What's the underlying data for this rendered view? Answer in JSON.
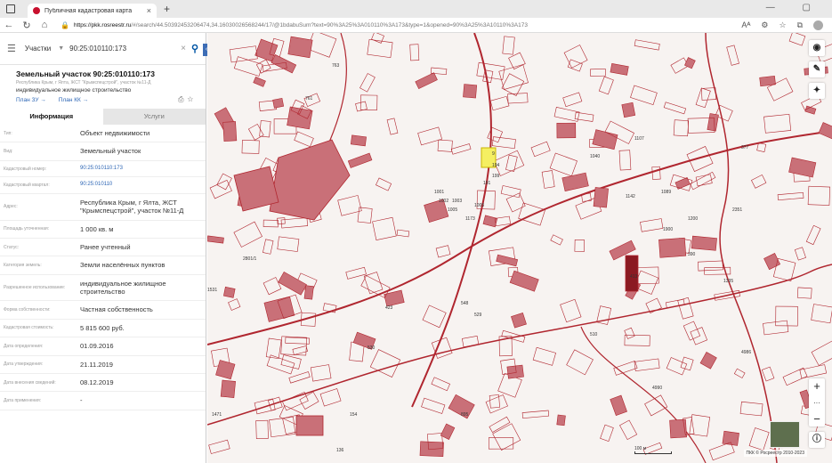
{
  "browser": {
    "tab_title": "Публичная кадастровая карта",
    "tab_close": "×",
    "new_tab": "+",
    "url_host": "https://pkk.rosreestr.ru",
    "url_rest": "/#/search/44.50392453206474,34.16030026568244/17/@1bdabuSum?text=90%3A25%3A010110%3A173&type=1&opened=90%3A25%3A10110%3A173",
    "aa_label": "Aᴬ"
  },
  "search": {
    "category": "Участки",
    "value": "90:25:010110:173"
  },
  "object": {
    "title": "Земельный участок 90:25:010110:173",
    "address_small": "Республика Крым, г Ялта, ЖСТ \"Крымспецстрой\", участок №11-Д",
    "use": "индивидуальное жилищное строительство",
    "plan_zu": "План ЗУ →",
    "plan_kk": "План КК →"
  },
  "tabs": {
    "info": "Информация",
    "services": "Услуги"
  },
  "rows": [
    {
      "k": "Тип:",
      "v": "Объект недвижимости",
      "link": false
    },
    {
      "k": "Вид:",
      "v": "Земельный участок",
      "link": false
    },
    {
      "k": "Кадастровый номер:",
      "v": "90:25:010110:173",
      "link": true
    },
    {
      "k": "Кадастровый квартал:",
      "v": "90:25:010110",
      "link": true
    },
    {
      "k": "Адрес:",
      "v": "Республика Крым, г Ялта, ЖСТ \"Крымспецстрой\", участок №11-Д",
      "link": false
    },
    {
      "k": "Площадь уточненная:",
      "v": "1 000 кв. м",
      "link": false
    },
    {
      "k": "Статус:",
      "v": "Ранее учтенный",
      "link": false
    },
    {
      "k": "Категория земель:",
      "v": "Земли населённых пунктов",
      "link": false
    },
    {
      "k": "Разрешенное использование:",
      "v": "индивидуальное жилищное строительство",
      "link": false
    },
    {
      "k": "Форма собственности:",
      "v": "Частная собственность",
      "link": false
    },
    {
      "k": "Кадастровая стоимость:",
      "v": "5 815 600 руб.",
      "link": false
    },
    {
      "k": "Дата определения:",
      "v": "01.09.2016",
      "link": false
    },
    {
      "k": "Дата утверждения:",
      "v": "21.11.2019",
      "link": false
    },
    {
      "k": "Дата внесения сведений:",
      "v": "08.12.2019",
      "link": false
    },
    {
      "k": "Дата применения:",
      "v": "-",
      "link": false
    }
  ],
  "map": {
    "labels": [
      "763",
      "761",
      "1089",
      "1142",
      "1200",
      "1900",
      "2351",
      "1335",
      "4986",
      "4990",
      "510",
      "530",
      "423",
      "895",
      "154",
      "136",
      "1471",
      "1531",
      "2801/1",
      "529",
      "548",
      "1001",
      "1002",
      "1003",
      "9",
      "199",
      "194",
      "1005",
      "191",
      "1173",
      "1005",
      "413",
      "390",
      "377",
      "1040",
      "1107"
    ],
    "scale": "100 м",
    "copyright": "ПКК © Росреестр 2010-2023",
    "zoom_in": "+",
    "zoom_out": "−",
    "zoom_level": "···"
  },
  "colors": {
    "accent": "#2d66b5",
    "parcel_line": "#b0262f",
    "parcel_fill": "#c97078",
    "highlight": "#f5ef62"
  }
}
